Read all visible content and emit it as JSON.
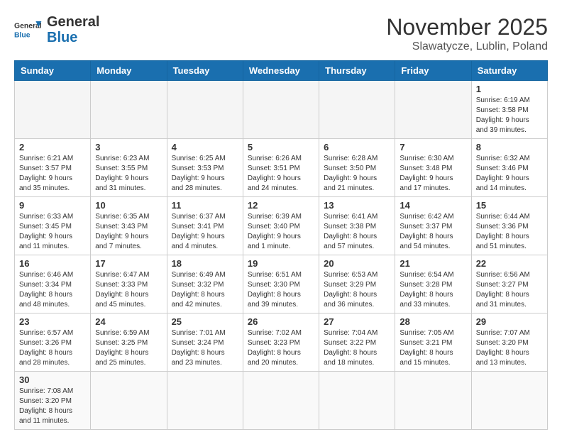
{
  "header": {
    "logo_general": "General",
    "logo_blue": "Blue",
    "month_year": "November 2025",
    "location": "Slawatycze, Lublin, Poland"
  },
  "days_of_week": [
    "Sunday",
    "Monday",
    "Tuesday",
    "Wednesday",
    "Thursday",
    "Friday",
    "Saturday"
  ],
  "weeks": [
    [
      {
        "day": "",
        "info": ""
      },
      {
        "day": "",
        "info": ""
      },
      {
        "day": "",
        "info": ""
      },
      {
        "day": "",
        "info": ""
      },
      {
        "day": "",
        "info": ""
      },
      {
        "day": "",
        "info": ""
      },
      {
        "day": "1",
        "info": "Sunrise: 6:19 AM\nSunset: 3:58 PM\nDaylight: 9 hours and 39 minutes."
      }
    ],
    [
      {
        "day": "2",
        "info": "Sunrise: 6:21 AM\nSunset: 3:57 PM\nDaylight: 9 hours and 35 minutes."
      },
      {
        "day": "3",
        "info": "Sunrise: 6:23 AM\nSunset: 3:55 PM\nDaylight: 9 hours and 31 minutes."
      },
      {
        "day": "4",
        "info": "Sunrise: 6:25 AM\nSunset: 3:53 PM\nDaylight: 9 hours and 28 minutes."
      },
      {
        "day": "5",
        "info": "Sunrise: 6:26 AM\nSunset: 3:51 PM\nDaylight: 9 hours and 24 minutes."
      },
      {
        "day": "6",
        "info": "Sunrise: 6:28 AM\nSunset: 3:50 PM\nDaylight: 9 hours and 21 minutes."
      },
      {
        "day": "7",
        "info": "Sunrise: 6:30 AM\nSunset: 3:48 PM\nDaylight: 9 hours and 17 minutes."
      },
      {
        "day": "8",
        "info": "Sunrise: 6:32 AM\nSunset: 3:46 PM\nDaylight: 9 hours and 14 minutes."
      }
    ],
    [
      {
        "day": "9",
        "info": "Sunrise: 6:33 AM\nSunset: 3:45 PM\nDaylight: 9 hours and 11 minutes."
      },
      {
        "day": "10",
        "info": "Sunrise: 6:35 AM\nSunset: 3:43 PM\nDaylight: 9 hours and 7 minutes."
      },
      {
        "day": "11",
        "info": "Sunrise: 6:37 AM\nSunset: 3:41 PM\nDaylight: 9 hours and 4 minutes."
      },
      {
        "day": "12",
        "info": "Sunrise: 6:39 AM\nSunset: 3:40 PM\nDaylight: 9 hours and 1 minute."
      },
      {
        "day": "13",
        "info": "Sunrise: 6:41 AM\nSunset: 3:38 PM\nDaylight: 8 hours and 57 minutes."
      },
      {
        "day": "14",
        "info": "Sunrise: 6:42 AM\nSunset: 3:37 PM\nDaylight: 8 hours and 54 minutes."
      },
      {
        "day": "15",
        "info": "Sunrise: 6:44 AM\nSunset: 3:36 PM\nDaylight: 8 hours and 51 minutes."
      }
    ],
    [
      {
        "day": "16",
        "info": "Sunrise: 6:46 AM\nSunset: 3:34 PM\nDaylight: 8 hours and 48 minutes."
      },
      {
        "day": "17",
        "info": "Sunrise: 6:47 AM\nSunset: 3:33 PM\nDaylight: 8 hours and 45 minutes."
      },
      {
        "day": "18",
        "info": "Sunrise: 6:49 AM\nSunset: 3:32 PM\nDaylight: 8 hours and 42 minutes."
      },
      {
        "day": "19",
        "info": "Sunrise: 6:51 AM\nSunset: 3:30 PM\nDaylight: 8 hours and 39 minutes."
      },
      {
        "day": "20",
        "info": "Sunrise: 6:53 AM\nSunset: 3:29 PM\nDaylight: 8 hours and 36 minutes."
      },
      {
        "day": "21",
        "info": "Sunrise: 6:54 AM\nSunset: 3:28 PM\nDaylight: 8 hours and 33 minutes."
      },
      {
        "day": "22",
        "info": "Sunrise: 6:56 AM\nSunset: 3:27 PM\nDaylight: 8 hours and 31 minutes."
      }
    ],
    [
      {
        "day": "23",
        "info": "Sunrise: 6:57 AM\nSunset: 3:26 PM\nDaylight: 8 hours and 28 minutes."
      },
      {
        "day": "24",
        "info": "Sunrise: 6:59 AM\nSunset: 3:25 PM\nDaylight: 8 hours and 25 minutes."
      },
      {
        "day": "25",
        "info": "Sunrise: 7:01 AM\nSunset: 3:24 PM\nDaylight: 8 hours and 23 minutes."
      },
      {
        "day": "26",
        "info": "Sunrise: 7:02 AM\nSunset: 3:23 PM\nDaylight: 8 hours and 20 minutes."
      },
      {
        "day": "27",
        "info": "Sunrise: 7:04 AM\nSunset: 3:22 PM\nDaylight: 8 hours and 18 minutes."
      },
      {
        "day": "28",
        "info": "Sunrise: 7:05 AM\nSunset: 3:21 PM\nDaylight: 8 hours and 15 minutes."
      },
      {
        "day": "29",
        "info": "Sunrise: 7:07 AM\nSunset: 3:20 PM\nDaylight: 8 hours and 13 minutes."
      }
    ],
    [
      {
        "day": "30",
        "info": "Sunrise: 7:08 AM\nSunset: 3:20 PM\nDaylight: 8 hours and 11 minutes."
      },
      {
        "day": "",
        "info": ""
      },
      {
        "day": "",
        "info": ""
      },
      {
        "day": "",
        "info": ""
      },
      {
        "day": "",
        "info": ""
      },
      {
        "day": "",
        "info": ""
      },
      {
        "day": "",
        "info": ""
      }
    ]
  ]
}
